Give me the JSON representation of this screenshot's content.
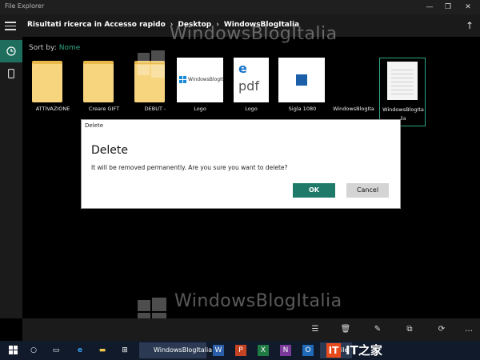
{
  "window": {
    "title": "File Explorer",
    "minimize": "—",
    "maximize": "❐",
    "close": "✕"
  },
  "nav": {
    "breadcrumb": [
      "Risultati ricerca in Accesso rapido",
      "Desktop",
      "WindowsBlogItalia"
    ],
    "separator": "›"
  },
  "sort": {
    "label": "Sort by:",
    "value": "Nome"
  },
  "files": [
    {
      "label": "ATTIVAZIONE",
      "sub": "",
      "type": "folder"
    },
    {
      "label": "Creare GIFT",
      "sub": "",
      "type": "folder"
    },
    {
      "label": "DEBUT -",
      "sub": "",
      "type": "folder"
    },
    {
      "label": "Logo",
      "sub": "",
      "type": "image-logo"
    },
    {
      "label": "Logo",
      "sub": "",
      "type": "pdf"
    },
    {
      "label": "Sigla 1080",
      "sub": "",
      "type": "video"
    },
    {
      "label": "WindowsBlogIta",
      "sub": "",
      "type": "blank"
    },
    {
      "label": "WindowsBlogIta",
      "sub": "lia",
      "type": "document"
    }
  ],
  "thumb_text": {
    "logo_brand": "WindowsBlogIt",
    "pdf": "pdf"
  },
  "dialog": {
    "title": "Delete",
    "heading": "Delete",
    "message": "It will be removed permanently. Are you sure you want to delete?",
    "ok": "OK",
    "cancel": "Cancel"
  },
  "watermark": {
    "text": "WindowsBlogItalia"
  },
  "commands": [
    "select-icon",
    "delete-icon",
    "rename-icon",
    "copy-icon",
    "share-icon",
    "more-icon"
  ],
  "command_glyphs": {
    "select": "☰",
    "delete": "🗑",
    "rename": "✎",
    "copy": "⧉",
    "share": "⟳",
    "more": "…"
  },
  "taskbar": {
    "task_label": "WindowsBlogItalia",
    "file_label": "File",
    "brand": "IT之家",
    "office_apps": [
      "W",
      "P",
      "X",
      "N",
      "O"
    ]
  },
  "colors": {
    "accent": "#2fa686",
    "ok_button": "#1f7a6a",
    "folder": "#f7d57e",
    "taskbar": "#101a2a"
  }
}
